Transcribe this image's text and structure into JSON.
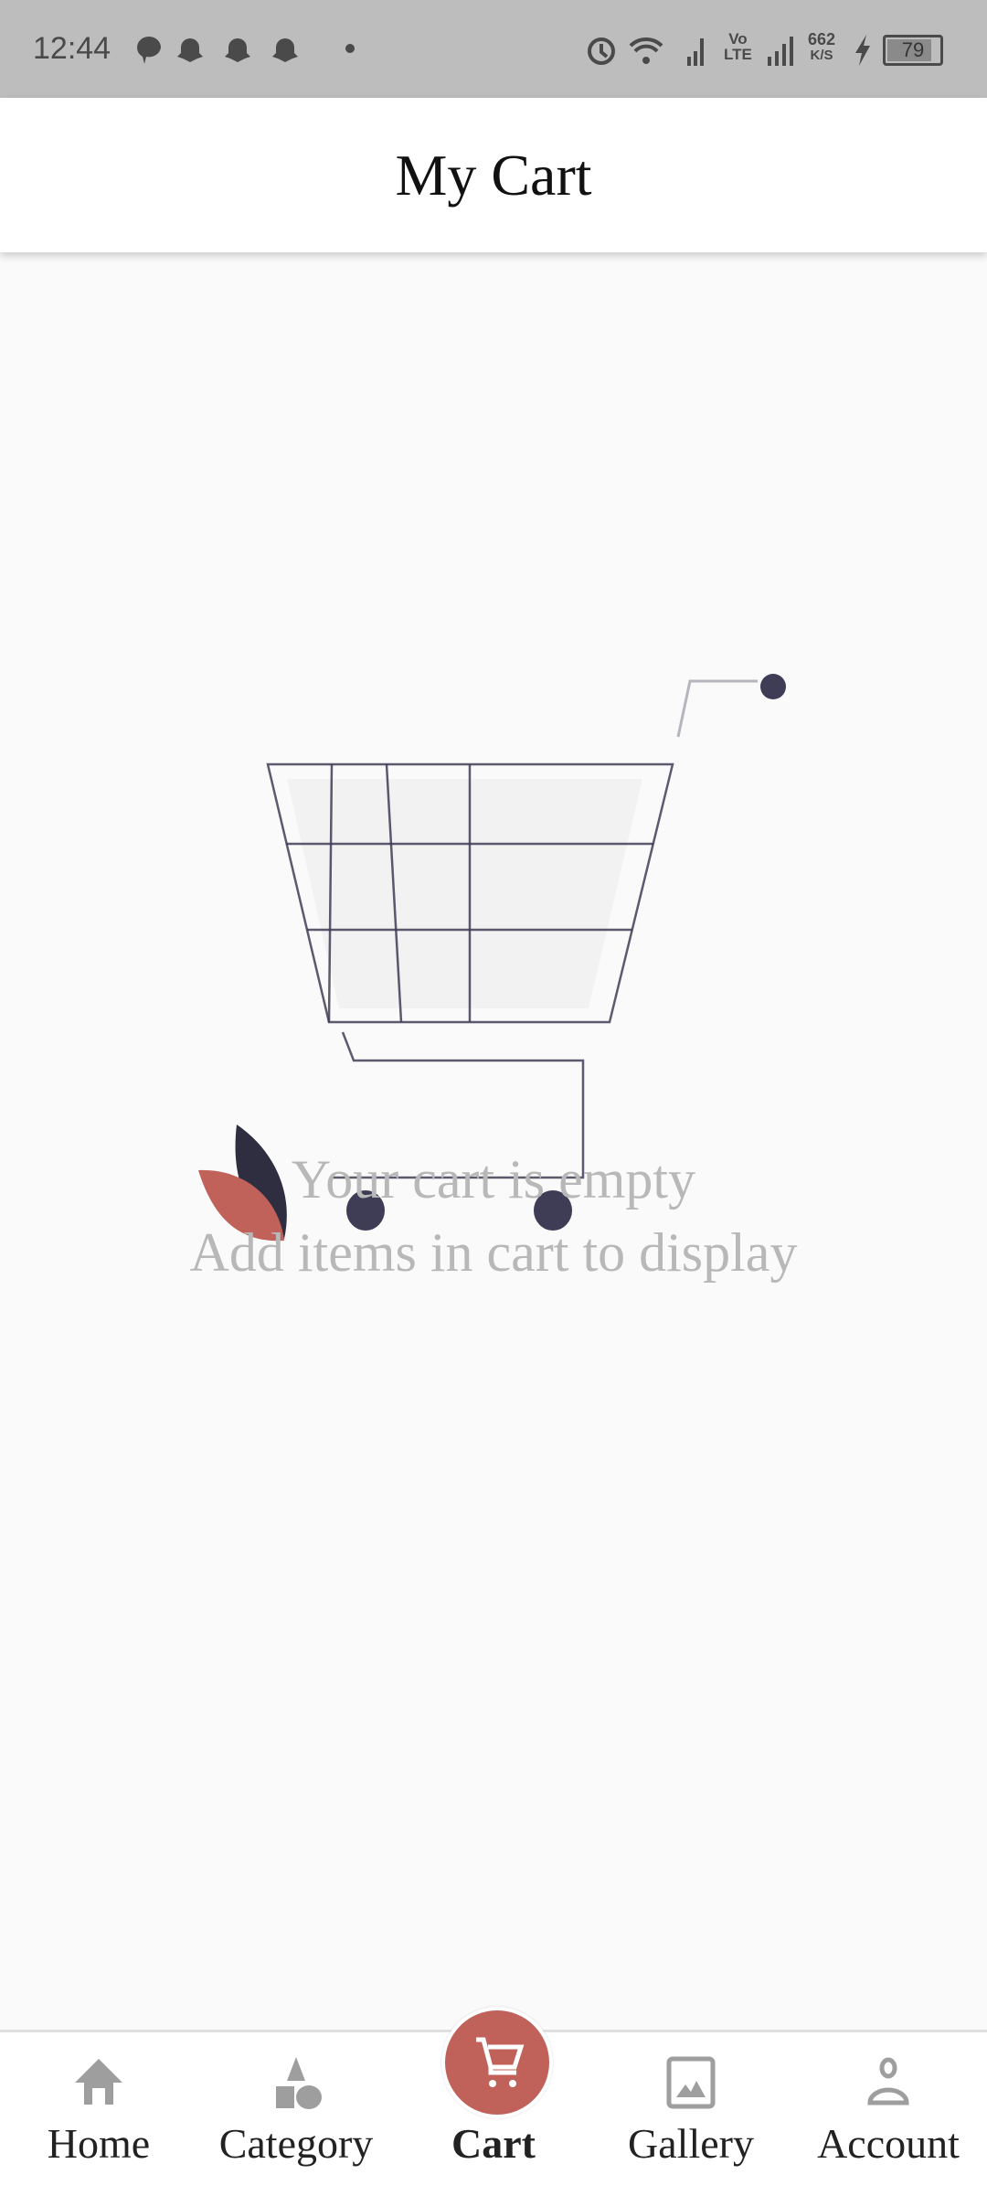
{
  "status_bar": {
    "time": "12:44",
    "network_speed_value": "662",
    "network_speed_unit": "K/S",
    "volte_top": "Vo",
    "volte_bottom": "LTE",
    "battery": "79",
    "icons": [
      "message-icon",
      "snapchat-icon",
      "snapchat-icon",
      "snapchat-icon",
      "dot-icon",
      "alarm-icon",
      "wifi-icon",
      "signal-icon",
      "signal-icon",
      "charging-icon",
      "battery-icon"
    ]
  },
  "app_bar": {
    "title": "My Cart"
  },
  "empty_state": {
    "line1": "Your cart is empty",
    "line2": "Add items in cart to display",
    "colors": {
      "accent": "#c0625a",
      "dark": "#3f3d56",
      "leaf_dark": "#2f2e41"
    }
  },
  "bottom_nav": {
    "active": "Cart",
    "items": [
      {
        "label": "Home",
        "icon": "home-icon"
      },
      {
        "label": "Category",
        "icon": "category-icon"
      },
      {
        "label": "Cart",
        "icon": "cart-icon"
      },
      {
        "label": "Gallery",
        "icon": "gallery-icon"
      },
      {
        "label": "Account",
        "icon": "account-icon"
      }
    ]
  }
}
